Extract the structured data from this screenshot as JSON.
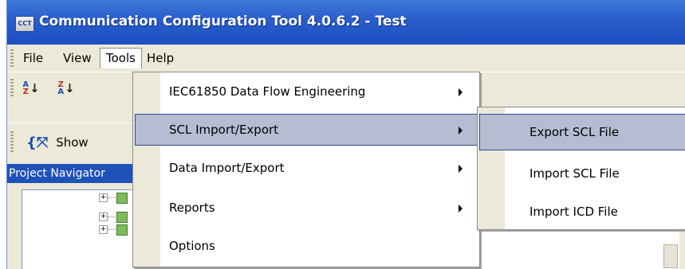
{
  "window": {
    "title": "Communication Configuration Tool 4.0.6.2 - Test",
    "icon_text": "CCT"
  },
  "menubar": {
    "items": [
      "File",
      "View",
      "Tools",
      "Help"
    ],
    "open_item": "Tools"
  },
  "toolbar": {
    "sort_az_label": "A Z",
    "sort_za_label": "Z A",
    "show_label": "Show"
  },
  "navigator": {
    "title": "Project Navigator"
  },
  "tools_menu": {
    "items": [
      {
        "label": "IEC61850 Data Flow Engineering",
        "submenu": true
      },
      {
        "label": "SCL Import/Export",
        "submenu": true,
        "highlighted": true
      },
      {
        "label": "Data Import/Export",
        "submenu": true
      },
      {
        "label": "Reports",
        "submenu": true
      },
      {
        "label": "Options",
        "submenu": false
      }
    ]
  },
  "scl_submenu": {
    "items": [
      {
        "label": "Export SCL File",
        "highlighted": true
      },
      {
        "label": "Import SCL File"
      },
      {
        "label": "Import ICD File"
      }
    ]
  },
  "colors": {
    "title_bar": "#2a5fce",
    "menu_highlight": "#b6bdd2",
    "highlight_border": "#2f4d8a",
    "navigator_header": "#1f52b8"
  }
}
